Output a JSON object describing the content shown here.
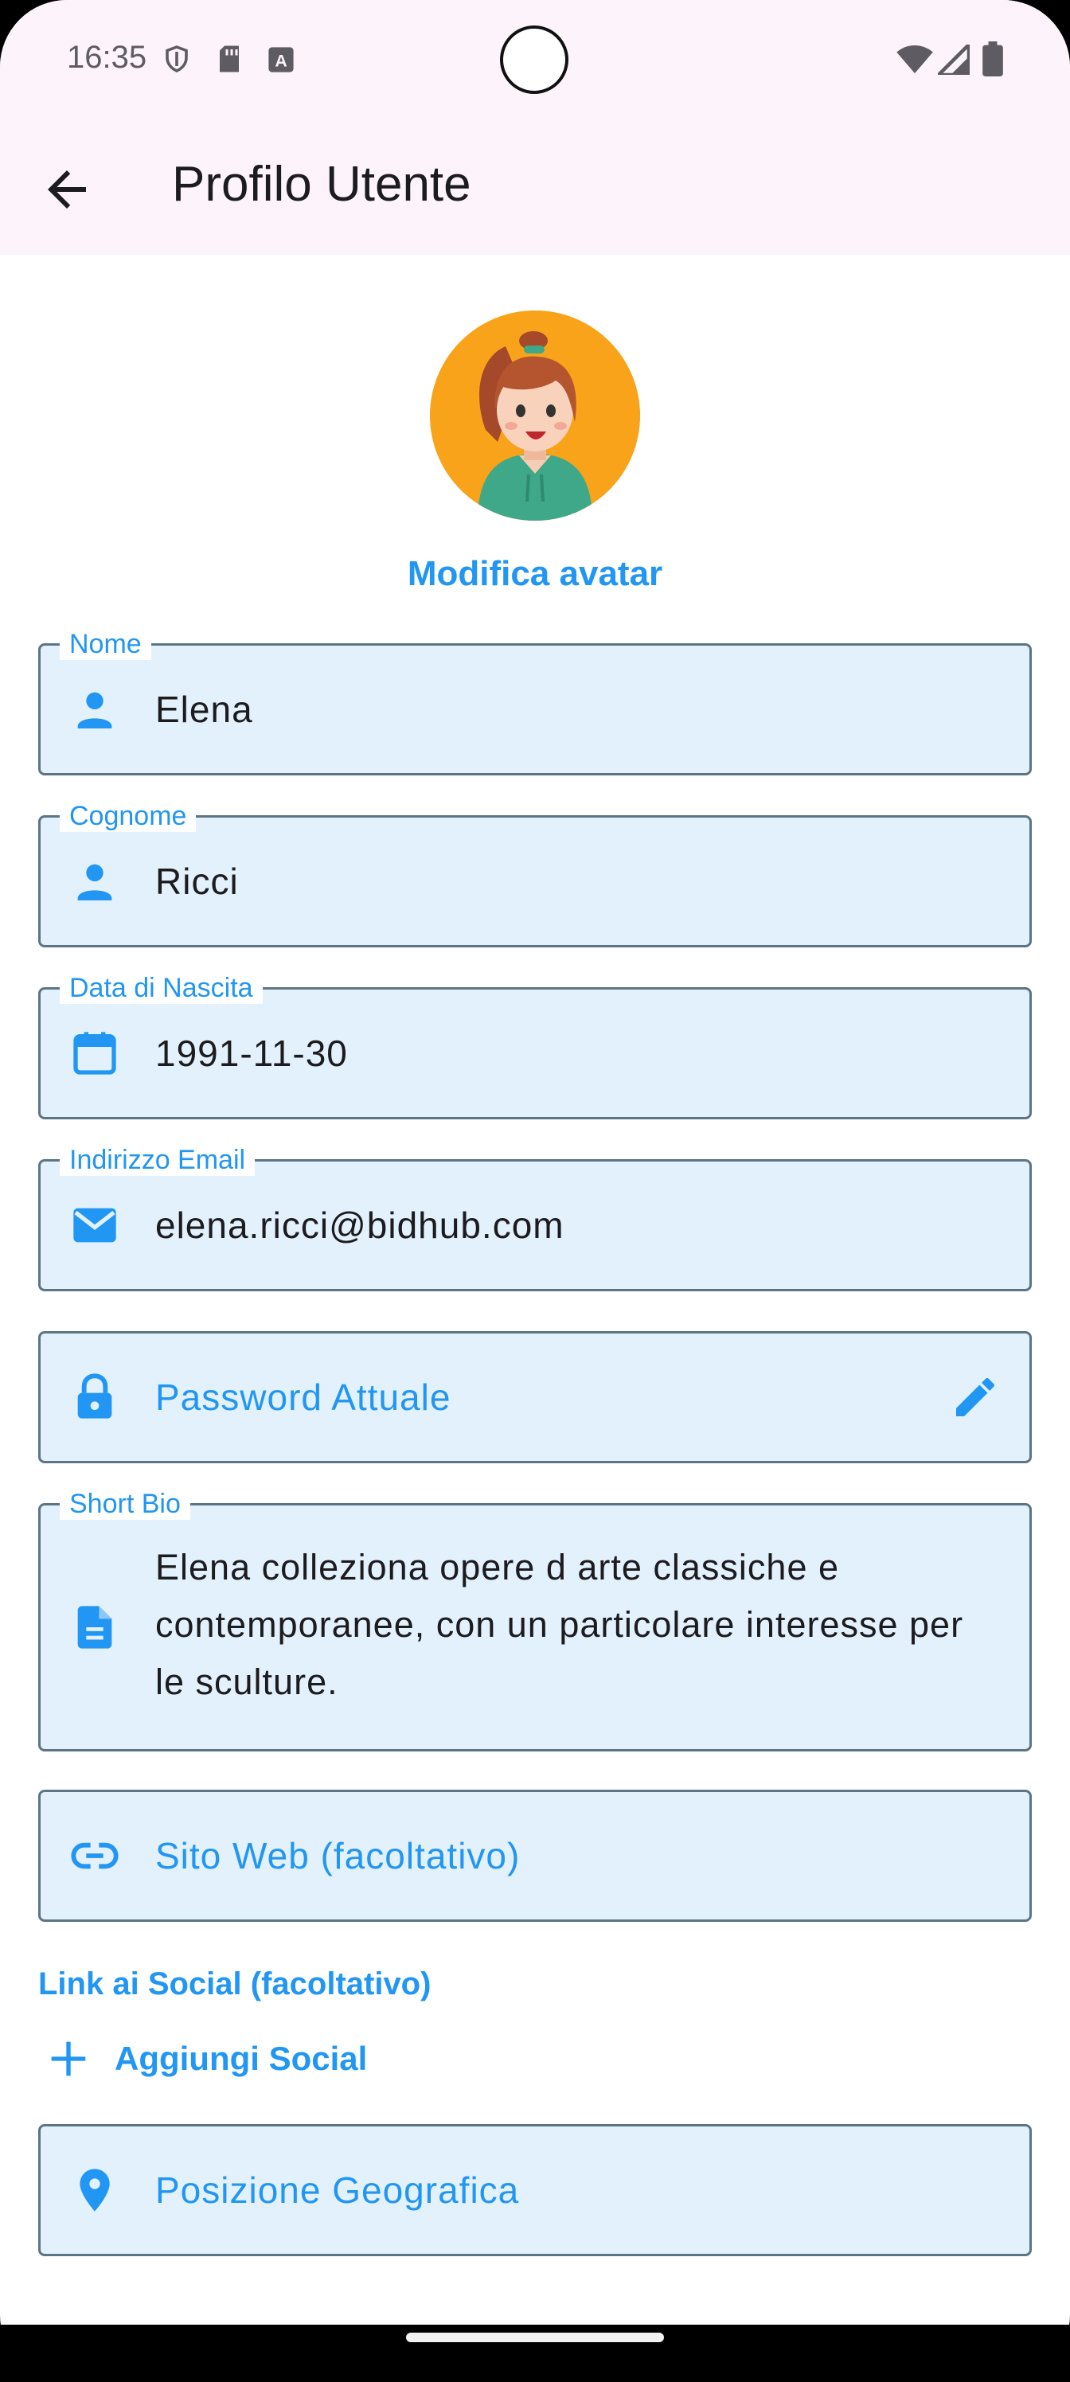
{
  "status_bar": {
    "time": "16:35"
  },
  "app_bar": {
    "title": "Profilo Utente"
  },
  "avatar": {
    "edit_label": "Modifica avatar"
  },
  "form": {
    "first_name": {
      "label": "Nome",
      "value": "Elena",
      "icon": "person-icon"
    },
    "last_name": {
      "label": "Cognome",
      "value": "Ricci",
      "icon": "person-icon"
    },
    "birth_date": {
      "label": "Data di Nascita",
      "value": "1991-11-30",
      "icon": "calendar-icon"
    },
    "email": {
      "label": "Indirizzo Email",
      "value": "elena.ricci@bidhub.com",
      "icon": "mail-icon"
    },
    "password": {
      "placeholder": "Password Attuale",
      "icon": "lock-icon"
    },
    "bio": {
      "label": "Short Bio",
      "value": "Elena colleziona opere d arte classiche e contemporanee, con un particolare interesse per le sculture.",
      "icon": "document-icon"
    },
    "website": {
      "placeholder": "Sito Web (facoltativo)",
      "icon": "link-icon"
    },
    "social_section_label": "Link ai Social (facoltativo)",
    "add_social_label": "Aggiungi Social",
    "location": {
      "placeholder": "Posizione Geografica",
      "icon": "location-pin-icon"
    }
  },
  "colors": {
    "accent": "#2196f3",
    "field_fill": "#e3f1fc",
    "app_bar_bg": "#fdf4fb",
    "avatar_bg": "#f9a31a"
  }
}
